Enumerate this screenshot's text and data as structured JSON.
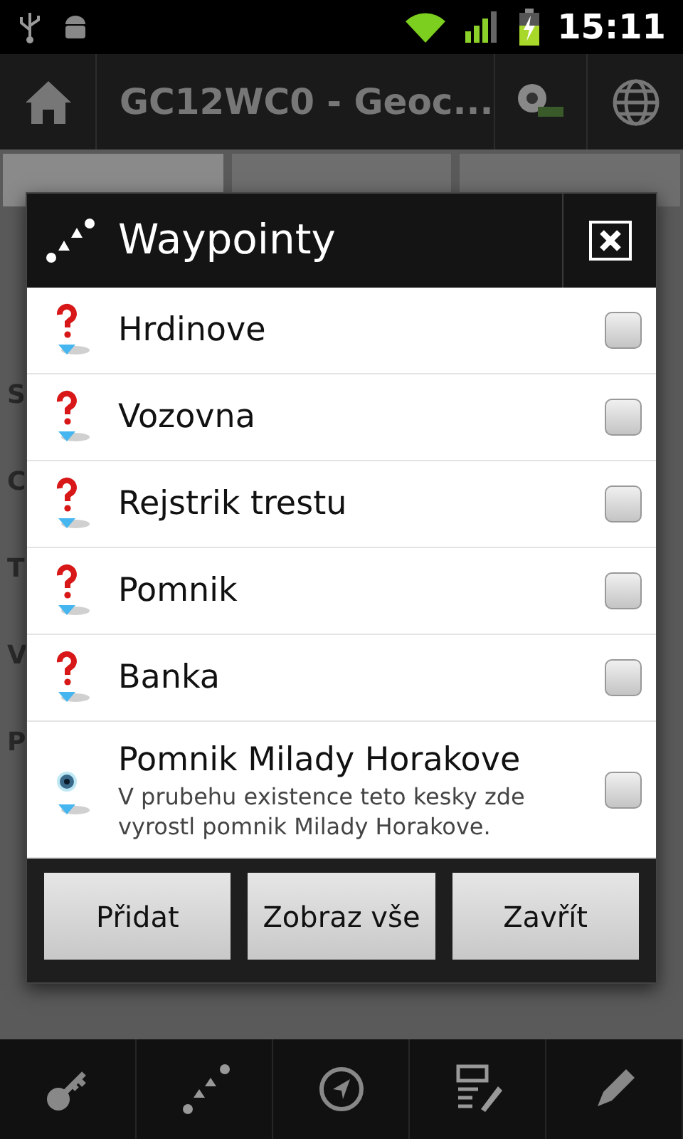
{
  "status_bar": {
    "time": "15:11"
  },
  "action_bar": {
    "title": "GC12WC0 - Geoc..."
  },
  "tabs": [
    {
      "selected": true
    },
    {
      "selected": false
    },
    {
      "selected": false
    }
  ],
  "background_labels": [
    "S",
    "C",
    "T",
    "V",
    "P"
  ],
  "dialog": {
    "title": "Waypointy",
    "items": [
      {
        "kind": "question",
        "name": "Hrdinove",
        "checked": false
      },
      {
        "kind": "question",
        "name": "Vozovna",
        "checked": false
      },
      {
        "kind": "question",
        "name": "Rejstrik trestu",
        "checked": false
      },
      {
        "kind": "question",
        "name": "Pomnik",
        "checked": false
      },
      {
        "kind": "question",
        "name": "Banka",
        "checked": false
      },
      {
        "kind": "reference",
        "name": "Pomnik Milady Horakove",
        "note": "V prubehu existence teto kesky zde vyrostl pomnik Milady Horakove.",
        "checked": false
      }
    ],
    "buttons": [
      "Přidat",
      "Zobraz vše",
      "Zavřít"
    ]
  }
}
